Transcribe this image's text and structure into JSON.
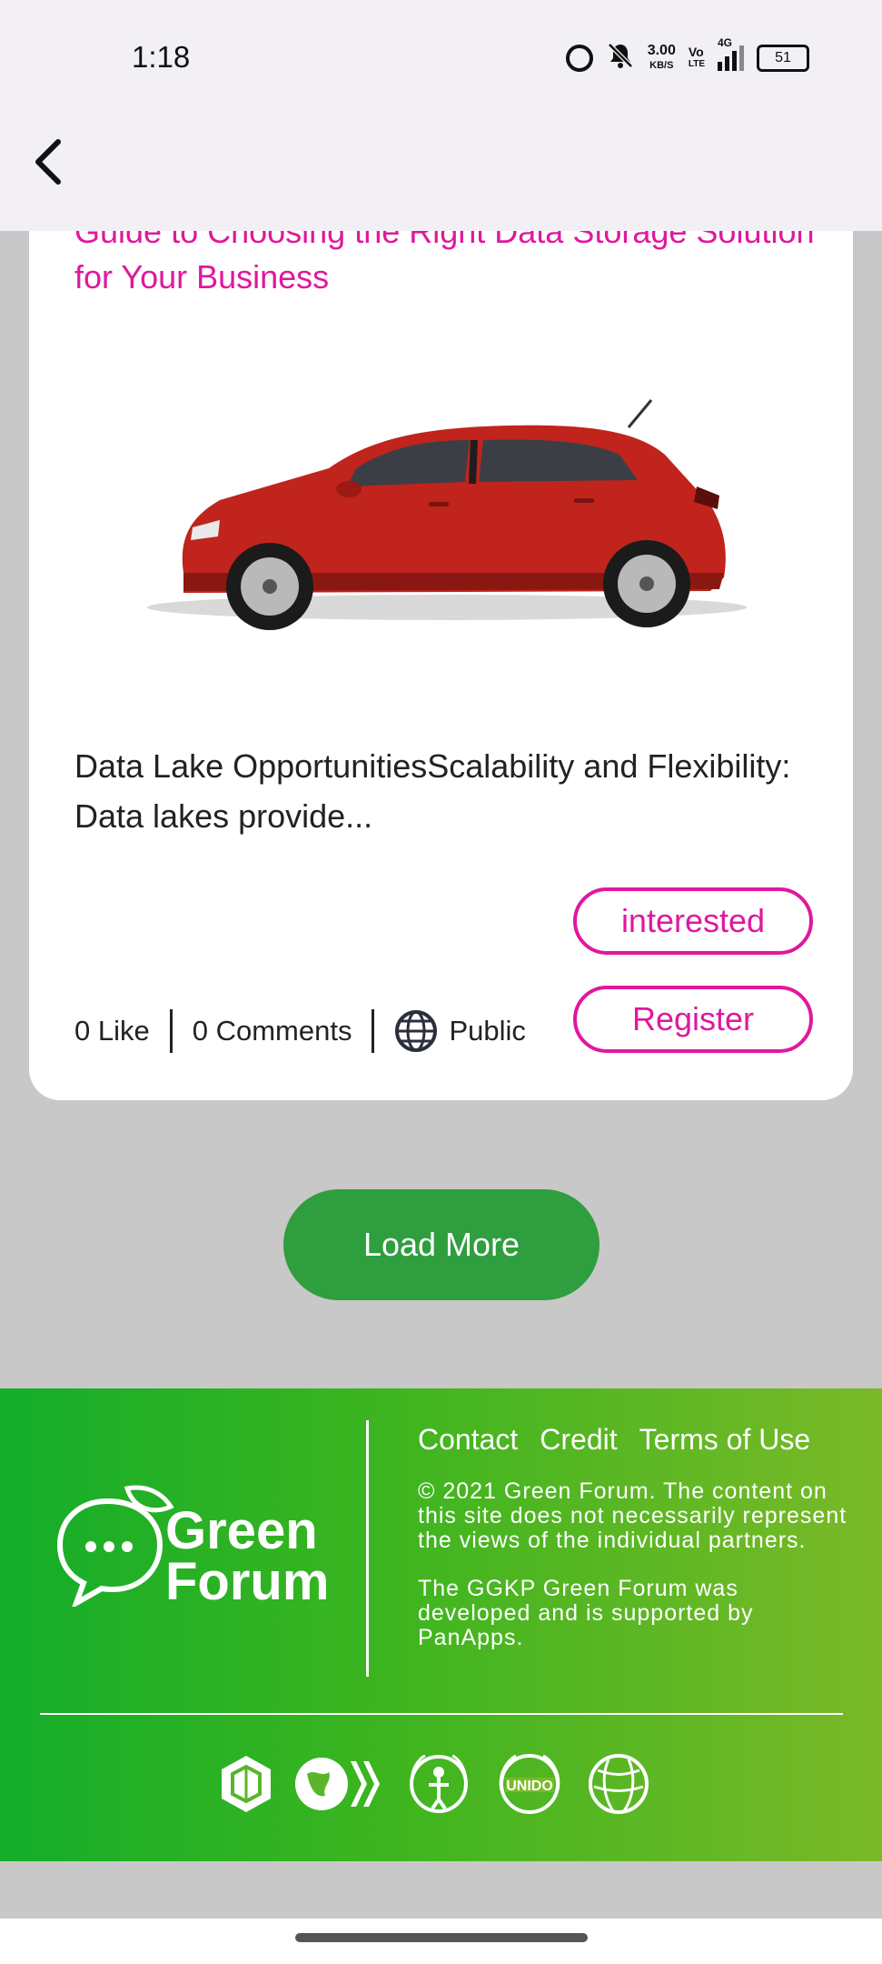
{
  "status_bar": {
    "time": "1:18",
    "net_speed_value": "3.00",
    "net_speed_unit": "KB/S",
    "volte_top": "Vo",
    "volte_bottom": "LTE",
    "network": "4G",
    "battery": "51"
  },
  "post": {
    "title": "Guide to Choosing the Right Data Storage Solution for Your Business",
    "excerpt": "Data Lake OpportunitiesScalability and Flexibility: Data lakes provide...",
    "interested_label": "interested",
    "register_label": "Register",
    "likes": "0 Like",
    "comments": "0 Comments",
    "visibility": "Public",
    "accent_color": "#e0189e"
  },
  "load_more_label": "Load More",
  "footer": {
    "logo_text_line1": "Green",
    "logo_text_line2": "Forum",
    "links": [
      "Contact",
      "Credit",
      "Terms of Use"
    ],
    "copyright": "© 2021 Green Forum. The content on this site does not necessarily represent the views of the individual partners.",
    "developed_by": "The GGKP Green Forum was developed and is supported by PanApps.",
    "partner_icons": [
      "ggkp-logo-icon",
      "globe-arrows-logo-icon",
      "un-environment-logo-icon",
      "unido-logo-icon",
      "world-bank-logo-icon"
    ]
  },
  "colors": {
    "load_more_bg": "#2e9e3e",
    "footer_gradient_start": "#14ad2a",
    "footer_gradient_end": "#7ab928"
  }
}
